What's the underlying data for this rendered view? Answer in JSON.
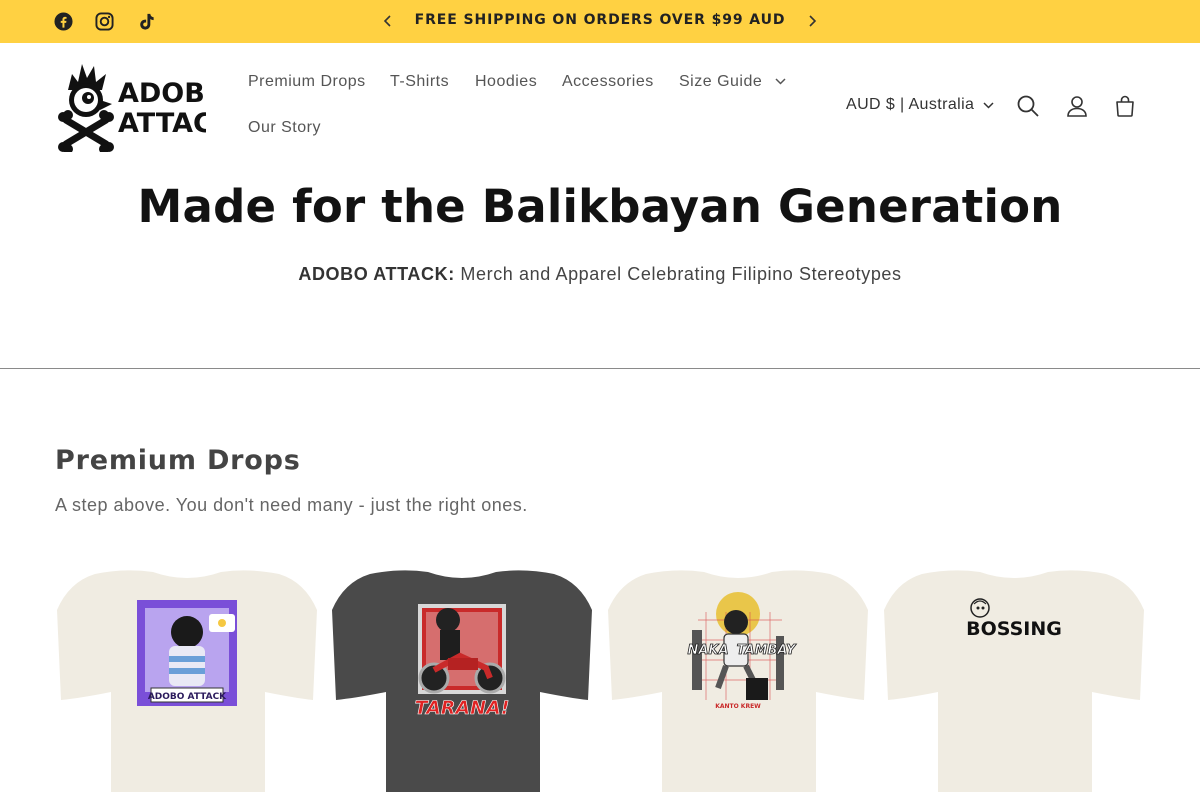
{
  "announcement": {
    "text": "FREE SHIPPING ON ORDERS OVER $99 AUD",
    "background": "#ffd142"
  },
  "social": [
    "facebook-icon",
    "instagram-icon",
    "tiktok-icon"
  ],
  "logo": {
    "line1": "ADOBO",
    "line2": "ATTACK"
  },
  "nav": {
    "items": [
      "Premium Drops",
      "T-Shirts",
      "Hoodies",
      "Accessories",
      "Size Guide",
      "Our Story"
    ]
  },
  "locale": {
    "label": "AUD $ | Australia"
  },
  "hero": {
    "title": "Made for the Balikbayan Generation",
    "brand": "ADOBO ATTACK:",
    "tagline": "Merch and Apparel Celebrating Filipino Stereotypes"
  },
  "section": {
    "title": "Premium Drops",
    "description": "A step above. You don't need many - just the right ones."
  },
  "products": [
    {
      "shirt_color": "#f0ece2",
      "graphic": "anime-girl-cafe",
      "graphic_text": "ADOBO ATTACK"
    },
    {
      "shirt_color": "#4a4a4a",
      "graphic": "motorcycle-rider",
      "graphic_text": "TARANA!"
    },
    {
      "shirt_color": "#f0ece2",
      "graphic": "sitting-guy",
      "graphic_text_left": "NAKA",
      "graphic_text_right": "TAMBAY",
      "graphic_caption": "KANTO KREW"
    },
    {
      "shirt_color": "#f0ece2",
      "graphic": "bossing",
      "graphic_text": "BOSSING"
    }
  ]
}
